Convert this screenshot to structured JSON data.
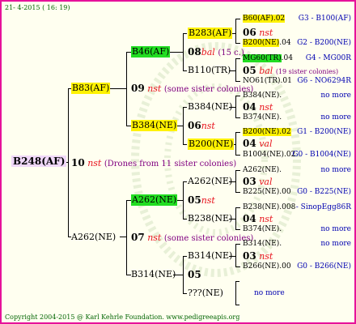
{
  "header": "21- 4-2015 ( 16: 19)",
  "footer": "Copyright 2004-2015 @ Karl Kehrle Foundation.   www.pedigreeapis.org",
  "root": {
    "id": "B248(AF)"
  },
  "gen1": {
    "mid": {
      "num": "10",
      "mark": "nst",
      "note": "(Drones from 11 sister colonies)"
    },
    "top": {
      "id": "B83(AF)",
      "num": "09",
      "mark": "nst",
      "note": "(some sister colonies)"
    },
    "bottom": {
      "id": "A262(NE)",
      "num": "07",
      "mark": "nst",
      "note": "(some sister colonies)"
    }
  },
  "gen2": {
    "b46": {
      "id": "B46(AF)",
      "num": "08",
      "mark": "bal",
      "note": "(15 c.)"
    },
    "b384": {
      "id": "B384(NE)",
      "num": "06",
      "mark": "nst"
    },
    "a262": {
      "id": "A262(NE)",
      "num": "05",
      "mark": "nst"
    },
    "b314": {
      "id": "B314(NE)",
      "num": "05"
    }
  },
  "gen3": {
    "b283": {
      "id": "B283(AF)",
      "num": "06",
      "mark": "nst"
    },
    "b110": {
      "id": "B110(TR)",
      "num": "05",
      "mark": "bal",
      "note": "(19 sister colonies)"
    },
    "b384": {
      "id": "B384(NE)",
      "num": "04",
      "mark": "nst"
    },
    "b200": {
      "id": "B200(NE)",
      "num": "04",
      "mark": "val"
    },
    "a262": {
      "id": "A262(NE)",
      "num": "03",
      "mark": "val"
    },
    "b238": {
      "id": "B238(NE)",
      "num": "04",
      "mark": "nst"
    },
    "b314": {
      "id": "B314(NE)",
      "num": "03",
      "mark": "nst"
    },
    "unk": {
      "id": "???(NE)"
    }
  },
  "gen4": {
    "r1": {
      "id": "B60(AF)",
      "val": ".02",
      "ref": "G3 - B100(AF)"
    },
    "r2": {
      "id": "B200(NE)",
      "val": ".04",
      "ref": "G2 - B200(NE)"
    },
    "r3": {
      "id": "MG60(TR)",
      "val": ".04",
      "ref": "G4 - MG00R"
    },
    "r4": {
      "id": "NO61(TR)",
      "val": ".01",
      "ref": "G6 - NO6294R"
    },
    "r5": {
      "id": "B384(NE)",
      "val": ".",
      "ref": "no more"
    },
    "r6": {
      "id": "B374(NE)",
      "val": ".",
      "ref": "no more"
    },
    "r7": {
      "id": "B200(NE)",
      "val": ".02",
      "ref": "G1 - B200(NE)"
    },
    "r8": {
      "id": "B1004(NE)",
      "val": ".02",
      "ref": "G0 - B1004(NE)"
    },
    "r9": {
      "id": "A262(NE)",
      "val": ".",
      "ref": "no more"
    },
    "r10": {
      "id": "B225(NE)",
      "val": ".00",
      "ref": "G0 - B225(NE)"
    },
    "r11": {
      "id": "B238(NE)",
      "val": ".008",
      "ref": "- SinopEgg86R"
    },
    "r12": {
      "id": "B374(NE)",
      "val": ".",
      "ref": "no more"
    },
    "r13": {
      "id": "B314(NE)",
      "val": ".",
      "ref": "no more"
    },
    "r14": {
      "id": "B266(NE)",
      "val": ".00",
      "ref": "G0 - B266(NE)"
    },
    "r15": {
      "ref": "no more"
    }
  }
}
